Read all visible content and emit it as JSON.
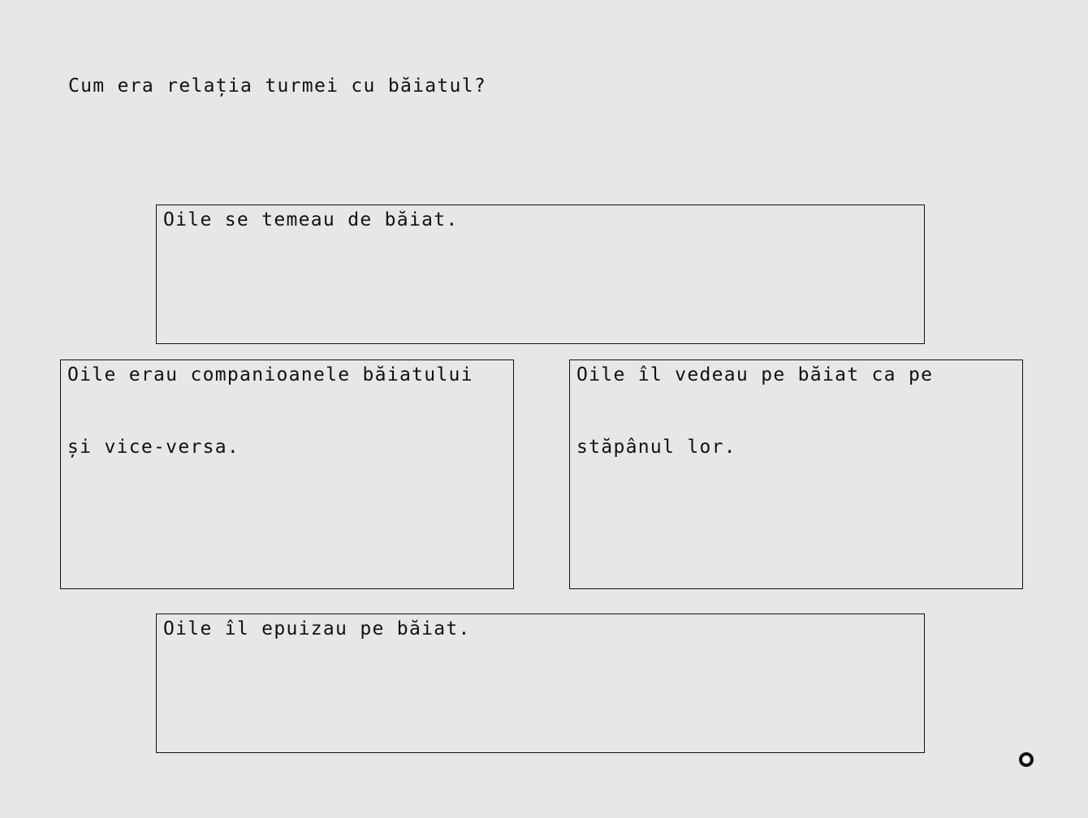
{
  "question": {
    "text": "Cum era relația turmei cu băiatul?"
  },
  "options": [
    {
      "text": "Oile se temeau de băiat."
    },
    {
      "text": "Oile erau companioanele băiatului și vice-versa."
    },
    {
      "text": "Oile îl vedeau pe băiat ca pe stăpânul lor."
    },
    {
      "text": "Oile îl epuizau pe băiat."
    }
  ],
  "cursor": {
    "icon": "circle-cursor-icon"
  }
}
